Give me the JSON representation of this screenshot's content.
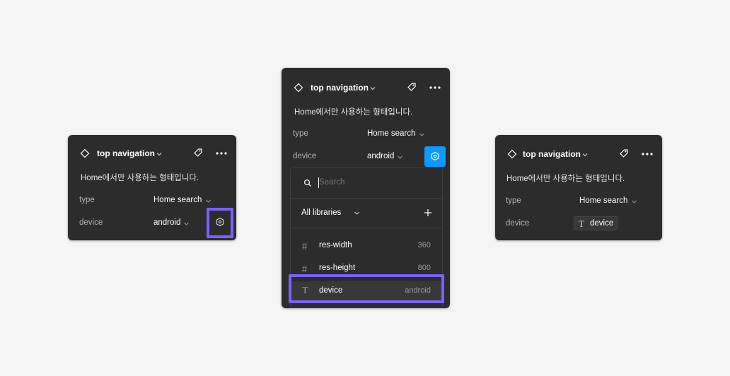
{
  "component": {
    "title": "top navigation",
    "description": "Home에서만 사용하는 형태입니다."
  },
  "properties": {
    "type_label": "type",
    "type_value": "Home search",
    "device_label": "device",
    "device_value": "android"
  },
  "variable_picker": {
    "search_placeholder": "Search",
    "library_filter": "All libraries",
    "items": [
      {
        "icon": "number-icon",
        "glyph": "#",
        "name": "res-width",
        "value": "360"
      },
      {
        "icon": "number-icon",
        "glyph": "#",
        "name": "res-height",
        "value": "800"
      },
      {
        "icon": "text-type-icon",
        "glyph": "T",
        "name": "device",
        "value": "android"
      }
    ]
  },
  "bound_variable": {
    "glyph": "T",
    "name": "device"
  },
  "colors": {
    "highlight": "#7b61ff",
    "accent": "#0d99ff",
    "panel_bg": "#2c2c2c"
  }
}
